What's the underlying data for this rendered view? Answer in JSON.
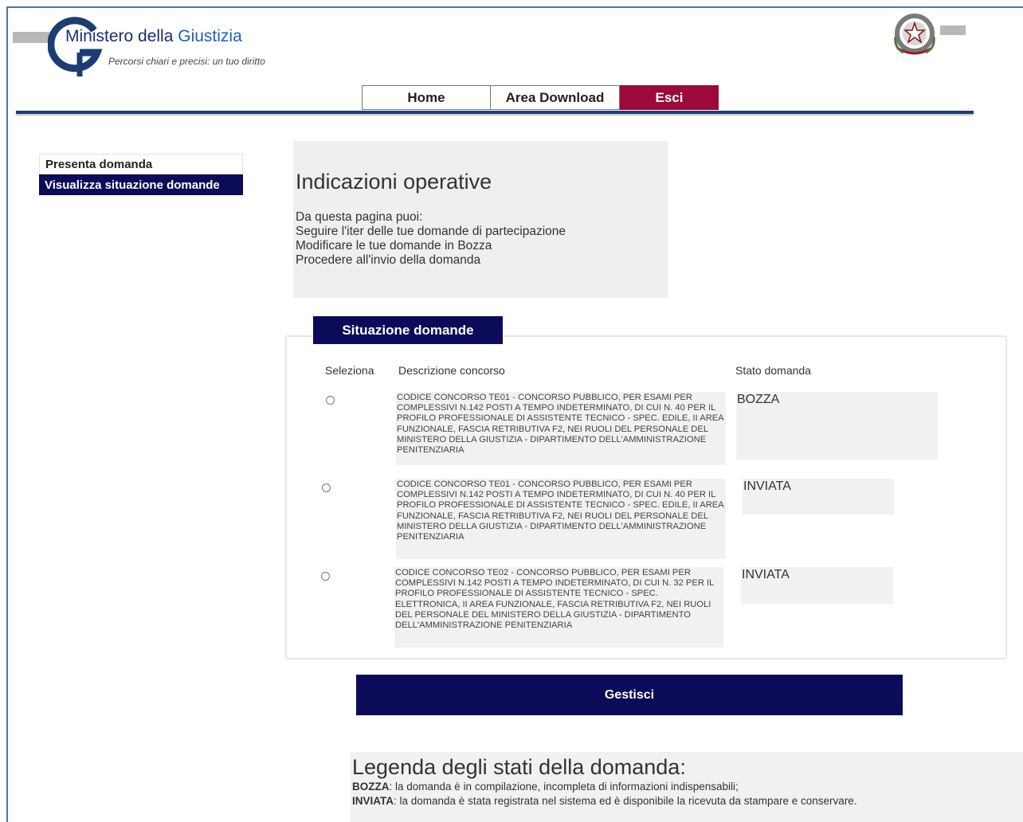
{
  "header": {
    "logo_title_prefix": "Ministero della ",
    "logo_title_accent": "Giustizia",
    "logo_subtitle": "Percorsi chiari e precisi: un tuo diritto"
  },
  "nav": {
    "home": "Home",
    "download": "Area Download",
    "exit": "Esci"
  },
  "sidebar": {
    "items": [
      {
        "label": "Presenta domanda",
        "active": false
      },
      {
        "label": "Visualizza situazione domande",
        "active": true
      }
    ]
  },
  "info": {
    "title": "Indicazioni operative",
    "lines": [
      "Da questa pagina puoi:",
      "Seguire l'iter delle tue domande di partecipazione",
      "Modificare le tue domande in Bozza",
      "Procedere all'invio della domanda"
    ]
  },
  "situazione": {
    "tab_label": "Situazione domande",
    "columns": [
      "Seleziona",
      "Descrizione concorso",
      "Stato domanda"
    ],
    "rows": [
      {
        "description": "CODICE CONCORSO TE01 - CONCORSO PUBBLICO, PER ESAMI PER COMPLESSIVI N.142 POSTI A TEMPO INDETERMINATO, DI CUI N. 40 PER IL PROFILO PROFESSIONALE DI ASSISTENTE TECNICO - SPEC. EDILE, II AREA FUNZIONALE, FASCIA RETRIBUTIVA F2, NEI RUOLI DEL PERSONALE DEL MINISTERO DELLA GIUSTIZIA - DIPARTIMENTO DELL'AMMINISTRAZIONE PENITENZIARIA",
        "state": "BOZZA"
      },
      {
        "description": "CODICE CONCORSO TE01 - CONCORSO PUBBLICO, PER ESAMI PER COMPLESSIVI N.142 POSTI A TEMPO INDETERMINATO, DI CUI N. 40 PER IL PROFILO PROFESSIONALE DI ASSISTENTE TECNICO - SPEC. EDILE, II AREA FUNZIONALE, FASCIA RETRIBUTIVA F2, NEI RUOLI DEL PERSONALE DEL MINISTERO DELLA GIUSTIZIA - DIPARTIMENTO DELL'AMMINISTRAZIONE PENITENZIARIA",
        "state": "INVIATA"
      },
      {
        "description": "CODICE CONCORSO TE02 - CONCORSO PUBBLICO, PER ESAMI PER COMPLESSIVI N.142 POSTI A TEMPO INDETERMINATO, DI CUI N. 32 PER IL PROFILO PROFESSIONALE DI ASSISTENTE TECNICO - SPEC. ELETTRONICA, II AREA FUNZIONALE, FASCIA RETRIBUTIVA F2, NEI RUOLI DEL PERSONALE DEL MINISTERO DELLA GIUSTIZIA - DIPARTIMENTO DELL'AMMINISTRAZIONE PENITENZIARIA",
        "state": "INVIATA"
      }
    ]
  },
  "actions": {
    "gestisci": "Gestisci"
  },
  "legend": {
    "title": "Legenda degli stati della domanda:",
    "bozza_key": "BOZZA",
    "bozza_text": ": la domanda è in compilazione, incompleta di informazioni indispensabili;",
    "inviata_key": "INVIATA",
    "inviata_text": ": la domanda è stata registrata nel sistema ed è disponibile la ricevuta da stampare e conservare."
  },
  "colors": {
    "navy": "#0c0b59",
    "exit_red": "#9b0a38",
    "header_line": "#1b3d73"
  }
}
